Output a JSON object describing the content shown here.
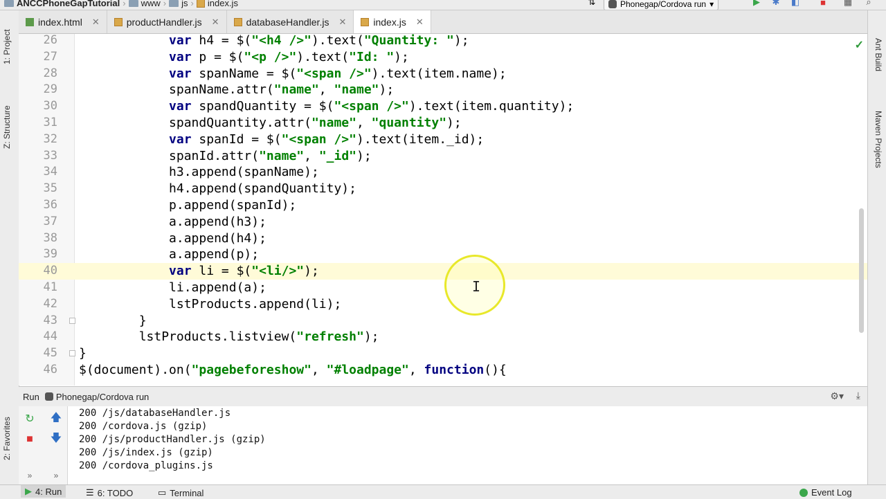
{
  "nav": {
    "project": "ANCCPhoneGapTutorial",
    "crumbs": [
      "www",
      "js",
      "index.js"
    ],
    "run_config": "Phonegap/Cordova run"
  },
  "tabs": [
    {
      "label": "index.html",
      "icon": "html-file-icon",
      "active": false
    },
    {
      "label": "productHandler.js",
      "icon": "js-file-icon",
      "active": false
    },
    {
      "label": "databaseHandler.js",
      "icon": "js-file-icon",
      "active": false
    },
    {
      "label": "index.js",
      "icon": "js-file-icon",
      "active": true
    }
  ],
  "left_tools": [
    "1: Project",
    "Z: Structure",
    "2: Favorites"
  ],
  "right_tools": [
    "Ant Build",
    "Maven Projects"
  ],
  "editor": {
    "current_line": "40",
    "lines": [
      {
        "n": "26",
        "text": "            var h4 = $(\"<h4 />\").text(\"Quantity: \");"
      },
      {
        "n": "27",
        "text": "            var p = $(\"<p />\").text(\"Id: \");"
      },
      {
        "n": "28",
        "text": "            var spanName = $(\"<span />\").text(item.name);"
      },
      {
        "n": "29",
        "text": "            spanName.attr(\"name\", \"name\");"
      },
      {
        "n": "30",
        "text": "            var spandQuantity = $(\"<span />\").text(item.quantity);"
      },
      {
        "n": "31",
        "text": "            spandQuantity.attr(\"name\", \"quantity\");"
      },
      {
        "n": "32",
        "text": "            var spanId = $(\"<span />\").text(item._id);"
      },
      {
        "n": "33",
        "text": "            spanId.attr(\"name\", \"_id\");"
      },
      {
        "n": "34",
        "text": "            h3.append(spanName);"
      },
      {
        "n": "35",
        "text": "            h4.append(spandQuantity);"
      },
      {
        "n": "36",
        "text": "            p.append(spanId);"
      },
      {
        "n": "37",
        "text": "            a.append(h3);"
      },
      {
        "n": "38",
        "text": "            a.append(h4);"
      },
      {
        "n": "39",
        "text": "            a.append(p);"
      },
      {
        "n": "40",
        "text": "            var li = $(\"<li/>\");"
      },
      {
        "n": "41",
        "text": "            li.append(a);"
      },
      {
        "n": "42",
        "text": "            lstProducts.append(li);"
      },
      {
        "n": "43",
        "text": "        }"
      },
      {
        "n": "44",
        "text": "        lstProducts.listview(\"refresh\");"
      },
      {
        "n": "45",
        "text": "}"
      },
      {
        "n": "46",
        "text": "$(document).on(\"pagebeforeshow\", \"#loadpage\", function(){"
      }
    ]
  },
  "run_panel": {
    "title": "Run",
    "config": "Phonegap/Cordova run",
    "console": [
      "200 /js/databaseHandler.js",
      "200 /cordova.js (gzip)",
      "200 /js/productHandler.js (gzip)",
      "200 /js/index.js (gzip)",
      "200 /cordova_plugins.js"
    ]
  },
  "bottom": {
    "run": "4: Run",
    "todo": "6: TODO",
    "terminal": "Terminal",
    "event_log": "Event Log"
  },
  "colors": {
    "keyword": "#000080",
    "string": "#008000",
    "current_line": "#fffbd8",
    "highlight": "#e8e82a"
  }
}
